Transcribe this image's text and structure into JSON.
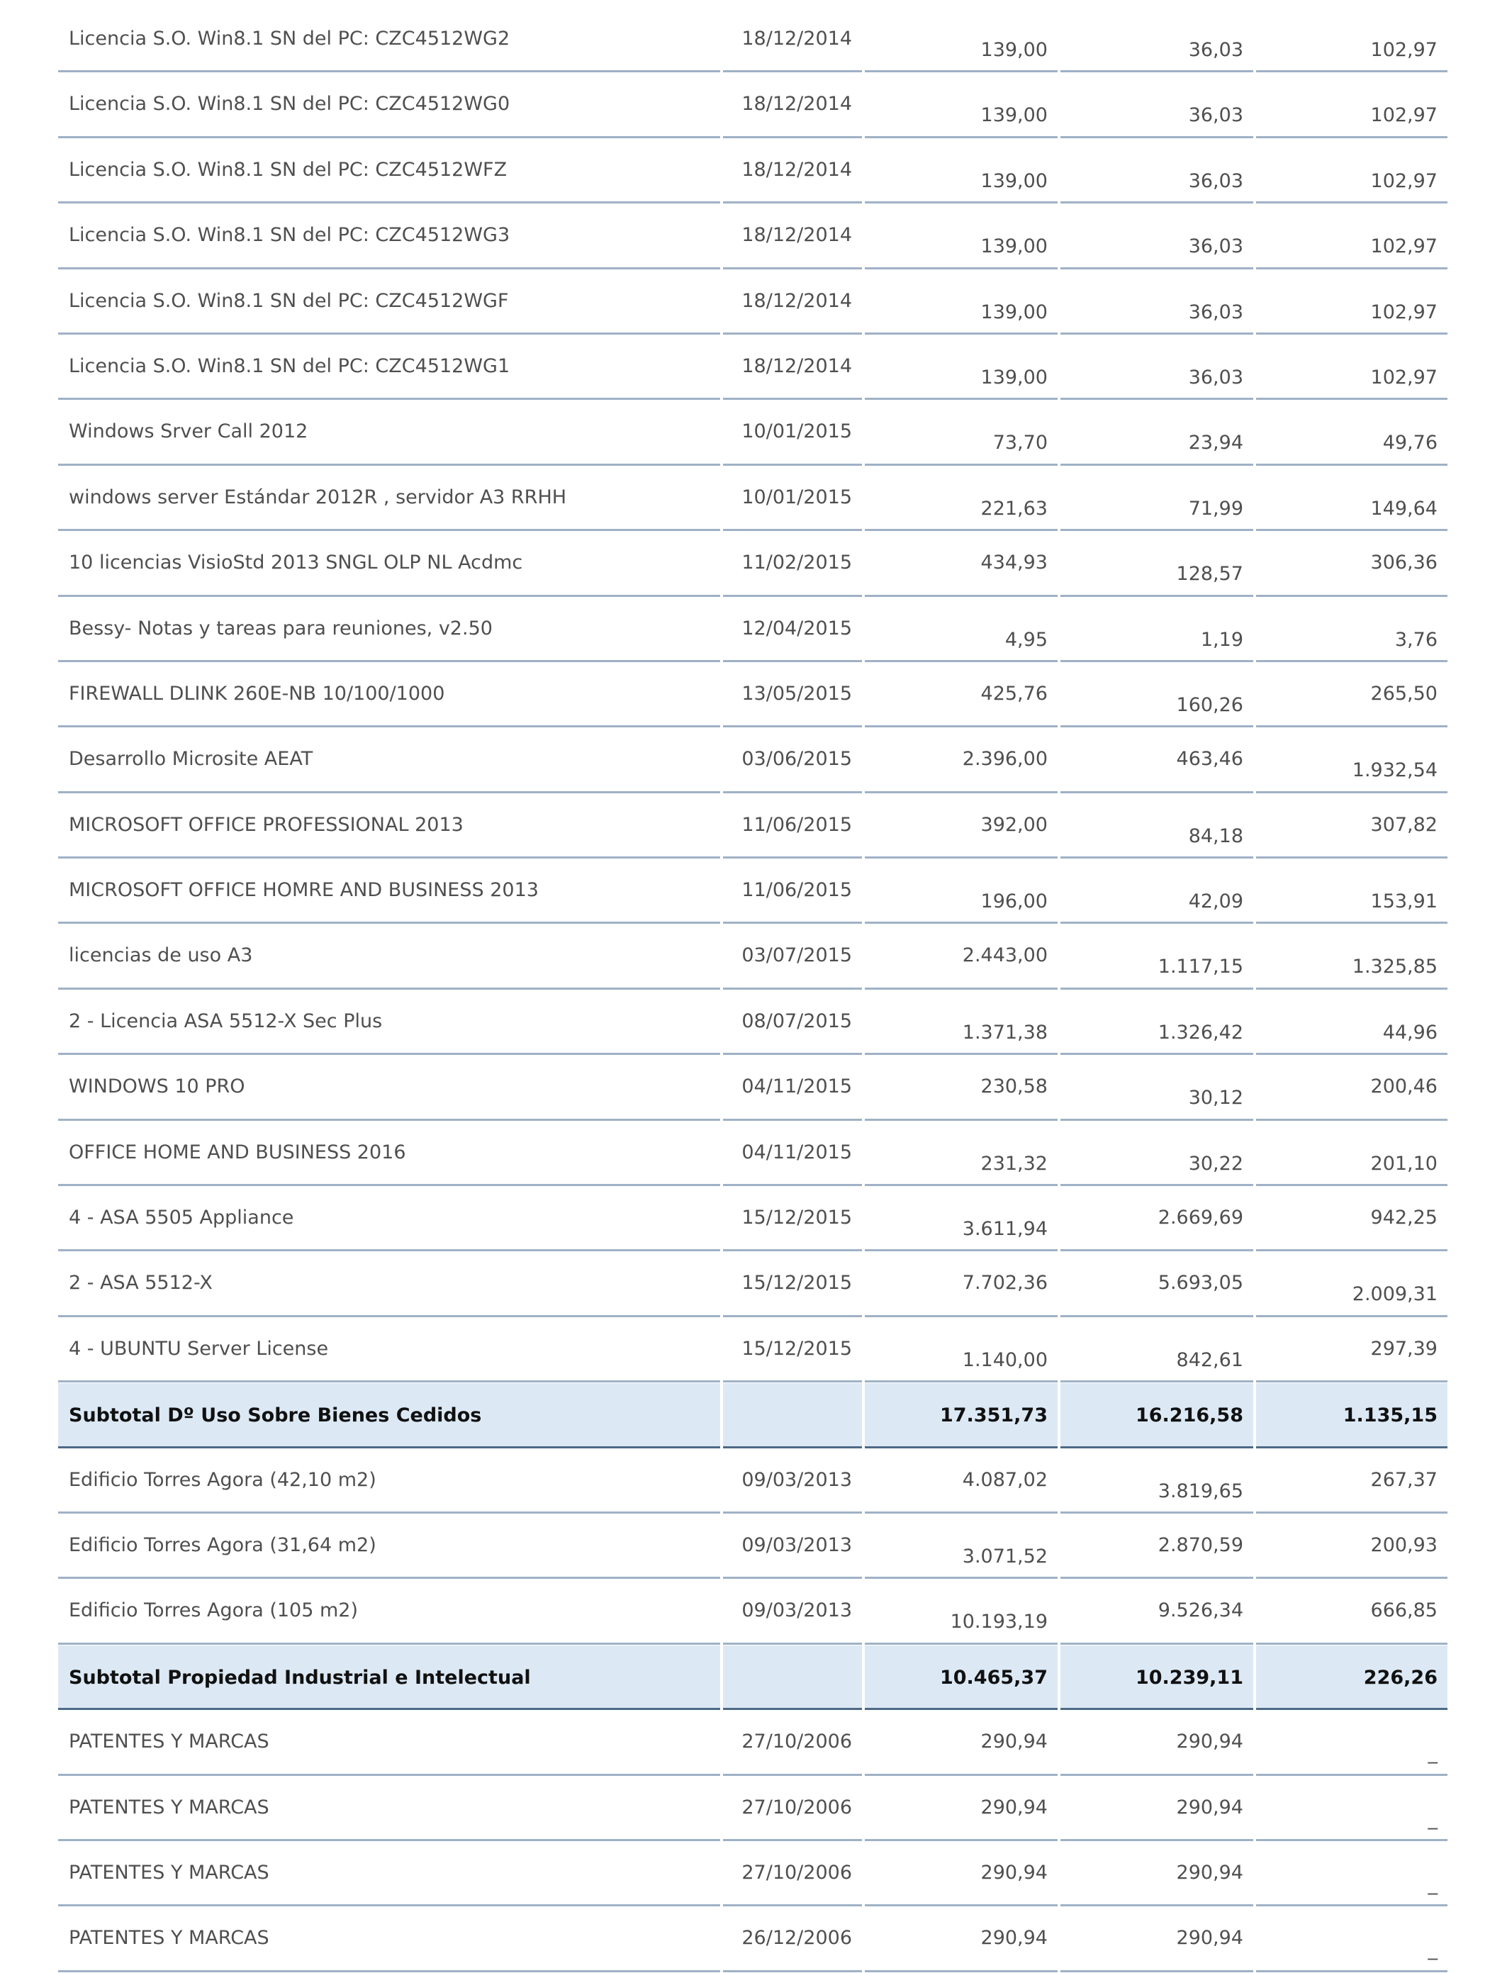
{
  "rows": [
    {
      "concept": "Licencia S.O. Win8.1 SN del PC: CZC4512WG2",
      "date": "18/12/2014",
      "v1": "139,00",
      "v2": "36,03",
      "v3": "102,97"
    },
    {
      "concept": "Licencia S.O. Win8.1 SN del PC: CZC4512WG0",
      "date": "18/12/2014",
      "v1": "139,00",
      "v2": "36,03",
      "v3": "102,97"
    },
    {
      "concept": "Licencia S.O. Win8.1 SN del PC: CZC4512WFZ",
      "date": "18/12/2014",
      "v1": "139,00",
      "v2": "36,03",
      "v3": "102,97"
    },
    {
      "concept": "Licencia S.O. Win8.1 SN del PC: CZC4512WG3",
      "date": "18/12/2014",
      "v1": "139,00",
      "v2": "36,03",
      "v3": "102,97"
    },
    {
      "concept": "Licencia S.O. Win8.1 SN del PC: CZC4512WGF",
      "date": "18/12/2014",
      "v1": "139,00",
      "v2": "36,03",
      "v3": "102,97"
    },
    {
      "concept": "Licencia S.O. Win8.1 SN del PC: CZC4512WG1",
      "date": "18/12/2014",
      "v1": "139,00",
      "v2": "36,03",
      "v3": "102,97"
    },
    {
      "concept": "Windows Srver Call 2012",
      "date": "10/01/2015",
      "v1": "73,70",
      "v2": "23,94",
      "v3": "49,76"
    },
    {
      "concept": "windows server Estándar 2012R , servidor A3 RRHH",
      "date": "10/01/2015",
      "v1": "221,63",
      "v2": "71,99",
      "v3": "149,64"
    },
    {
      "concept": "10 licencias VisioStd 2013 SNGL OLP NL Acdmc",
      "date": "11/02/2015",
      "v1": "434,93",
      "v2": "128,57",
      "v3": "306,36"
    },
    {
      "concept": "Bessy- Notas y tareas para reuniones, v2.50",
      "date": "12/04/2015",
      "v1": "4,95",
      "v2": "1,19",
      "v3": "3,76"
    },
    {
      "concept": "FIREWALL DLINK 260E-NB 10/100/1000",
      "date": "13/05/2015",
      "v1": "425,76",
      "v2": "160,26",
      "v3": "265,50"
    },
    {
      "concept": "Desarrollo Microsite AEAT",
      "date": "03/06/2015",
      "v1": "2.396,00",
      "v2": "463,46",
      "v3": "1.932,54"
    },
    {
      "concept": "MICROSOFT OFFICE PROFESSIONAL 2013",
      "date": "11/06/2015",
      "v1": "392,00",
      "v2": "84,18",
      "v3": "307,82"
    },
    {
      "concept": "MICROSOFT OFFICE HOMRE AND BUSINESS 2013",
      "date": "11/06/2015",
      "v1": "196,00",
      "v2": "42,09",
      "v3": "153,91"
    },
    {
      "concept": "licencias de uso A3",
      "date": "03/07/2015",
      "v1": "2.443,00",
      "v2": "1.117,15",
      "v3": "1.325,85"
    },
    {
      "concept": "2 - Licencia ASA 5512-X Sec Plus",
      "date": "08/07/2015",
      "v1": "1.371,38",
      "v2": "1.326,42",
      "v3": "44,96"
    },
    {
      "concept": "WINDOWS 10 PRO",
      "date": "04/11/2015",
      "v1": "230,58",
      "v2": "30,12",
      "v3": "200,46"
    },
    {
      "concept": "OFFICE HOME AND BUSINESS 2016",
      "date": "04/11/2015",
      "v1": "231,32",
      "v2": "30,22",
      "v3": "201,10"
    },
    {
      "concept": "4 - ASA 5505 Appliance",
      "date": "15/12/2015",
      "v1": "3.611,94",
      "v2": "2.669,69",
      "v3": "942,25"
    },
    {
      "concept": "2 - ASA 5512-X",
      "date": "15/12/2015",
      "v1": "7.702,36",
      "v2": "5.693,05",
      "v3": "2.009,31"
    },
    {
      "concept": "4 - UBUNTU Server License",
      "date": "15/12/2015",
      "v1": "1.140,00",
      "v2": "842,61",
      "v3": "297,39"
    },
    {
      "concept": "Subtotal Dº Uso Sobre Bienes Cedidos",
      "date": "",
      "v1": "17.351,73",
      "v2": "16.216,58",
      "v3": "1.135,15",
      "subtotal": true
    },
    {
      "concept": "Edificio Torres Agora (42,10 m2)",
      "date": "09/03/2013",
      "v1": "4.087,02",
      "v2": "3.819,65",
      "v3": "267,37"
    },
    {
      "concept": "Edificio Torres Agora (31,64 m2)",
      "date": "09/03/2013",
      "v1": "3.071,52",
      "v2": "2.870,59",
      "v3": "200,93"
    },
    {
      "concept": "Edificio Torres Agora (105 m2)",
      "date": "09/03/2013",
      "v1": "10.193,19",
      "v2": "9.526,34",
      "v3": "666,85"
    },
    {
      "concept": "Subtotal Propiedad Industrial e Intelectual",
      "date": "",
      "v1": "10.465,37",
      "v2": "10.239,11",
      "v3": "226,26",
      "subtotal": true
    },
    {
      "concept": "PATENTES Y MARCAS",
      "date": "27/10/2006",
      "v1": "290,94",
      "v2": "290,94",
      "v3": "_"
    },
    {
      "concept": "PATENTES Y MARCAS",
      "date": "27/10/2006",
      "v1": "290,94",
      "v2": "290,94",
      "v3": "_"
    },
    {
      "concept": "PATENTES Y MARCAS",
      "date": "27/10/2006",
      "v1": "290,94",
      "v2": "290,94",
      "v3": "_"
    },
    {
      "concept": "PATENTES Y MARCAS",
      "date": "26/12/2006",
      "v1": "290,94",
      "v2": "290,94",
      "v3": "_"
    }
  ],
  "colors": {
    "row_rule": "#9fb1c6",
    "subtotal_bg": "#dce9f5",
    "subtotal_rule": "#4e6a86",
    "text": "#4f4f4f"
  }
}
